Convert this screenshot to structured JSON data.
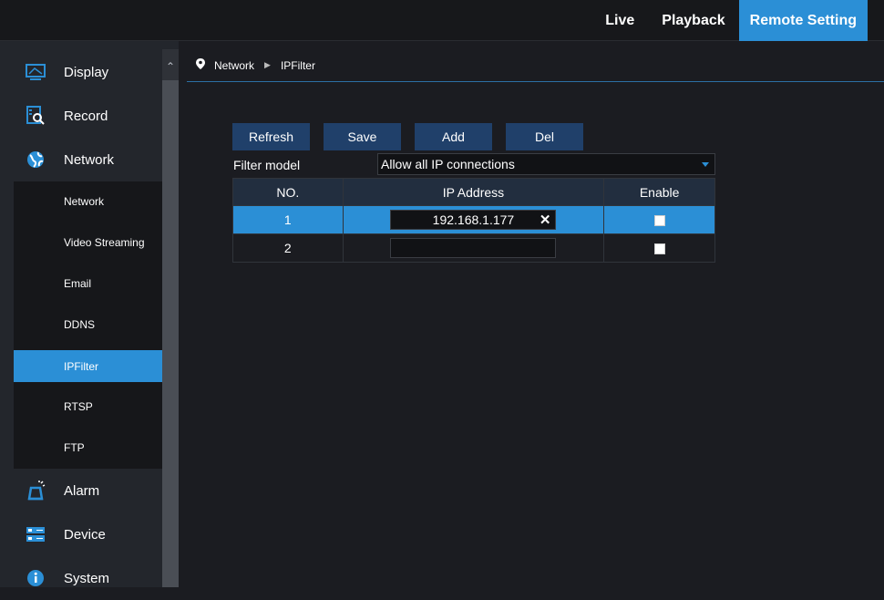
{
  "topnav": {
    "live": "Live",
    "playback": "Playback",
    "remote_setting": "Remote Setting"
  },
  "sidebar": {
    "display": "Display",
    "record": "Record",
    "network": "Network",
    "alarm": "Alarm",
    "device": "Device",
    "system": "System",
    "network_sub": [
      "Network",
      "Video Streaming",
      "Email",
      "DDNS",
      "IPFilter",
      "RTSP",
      "FTP"
    ]
  },
  "breadcrumb": {
    "parent": "Network",
    "current": "IPFilter"
  },
  "toolbar": {
    "refresh": "Refresh",
    "save": "Save",
    "add": "Add",
    "del": "Del"
  },
  "filter": {
    "label": "Filter model",
    "value": "Allow all IP connections"
  },
  "table": {
    "headers": {
      "no": "NO.",
      "ip": "IP Address",
      "enable": "Enable"
    },
    "rows": [
      {
        "no": "1",
        "ip": "192.168.1.177",
        "enabled": false,
        "selected": true
      },
      {
        "no": "2",
        "ip": "",
        "enabled": false,
        "selected": false
      }
    ]
  },
  "colors": {
    "accent": "#2b8fd6",
    "button": "#20406a",
    "header": "#222e3f",
    "sidebar": "#23262c"
  }
}
